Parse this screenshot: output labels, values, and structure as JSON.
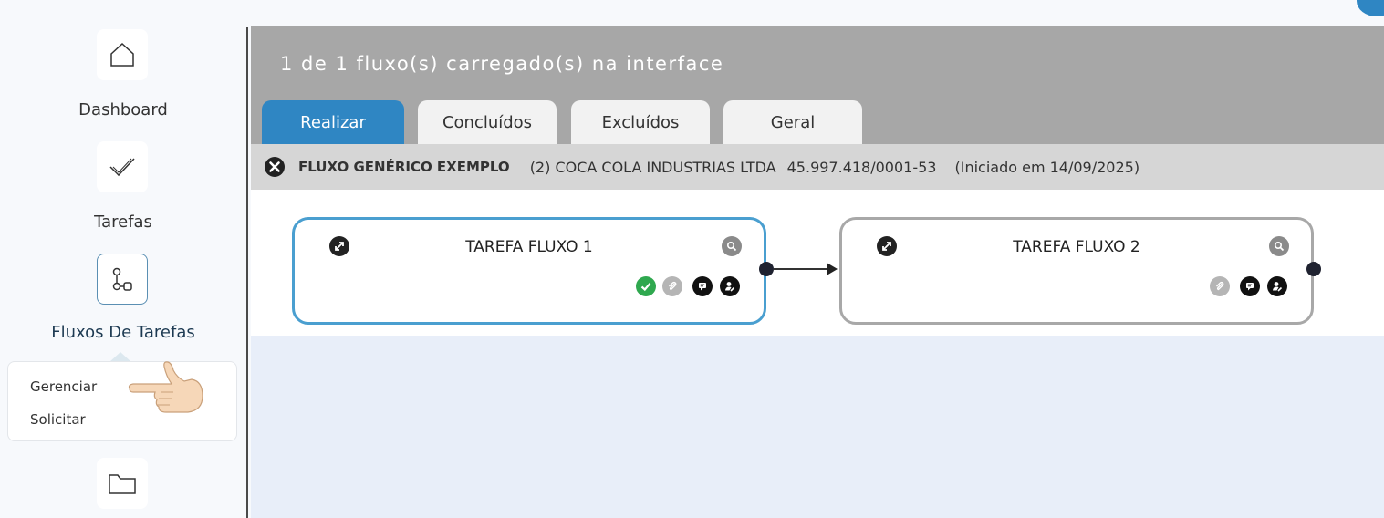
{
  "sidebar": {
    "items": [
      {
        "label": "Dashboard",
        "icon": "home-icon"
      },
      {
        "label": "Tarefas",
        "icon": "check-icon"
      },
      {
        "label": "Fluxos De Tarefas",
        "icon": "flow-icon"
      },
      {
        "label": "",
        "icon": "folder-icon"
      }
    ],
    "submenu": [
      "Gerenciar",
      "Solicitar"
    ]
  },
  "header": {
    "title": "1 de 1 fluxo(s) carregado(s) na interface",
    "tabs": [
      "Realizar",
      "Concluídos",
      "Excluídos",
      "Geral"
    ],
    "active_tab": "Realizar"
  },
  "flow": {
    "name": "FLUXO GENÉRICO EXEMPLO",
    "company": "(2) COCA COLA INDUSTRIAS LTDA",
    "cnpj": "45.997.418/0001-53",
    "started": "(Iniciado em 14/09/2025)"
  },
  "tasks": [
    {
      "title": "TAREFA FLUXO 1",
      "status": "active"
    },
    {
      "title": "TAREFA FLUXO 2",
      "status": "pending"
    }
  ],
  "colors": {
    "accent": "#2f86c3",
    "active_border": "#4a9fd0",
    "pending_border": "#a8a8a8",
    "done_green": "#2fa84f"
  }
}
